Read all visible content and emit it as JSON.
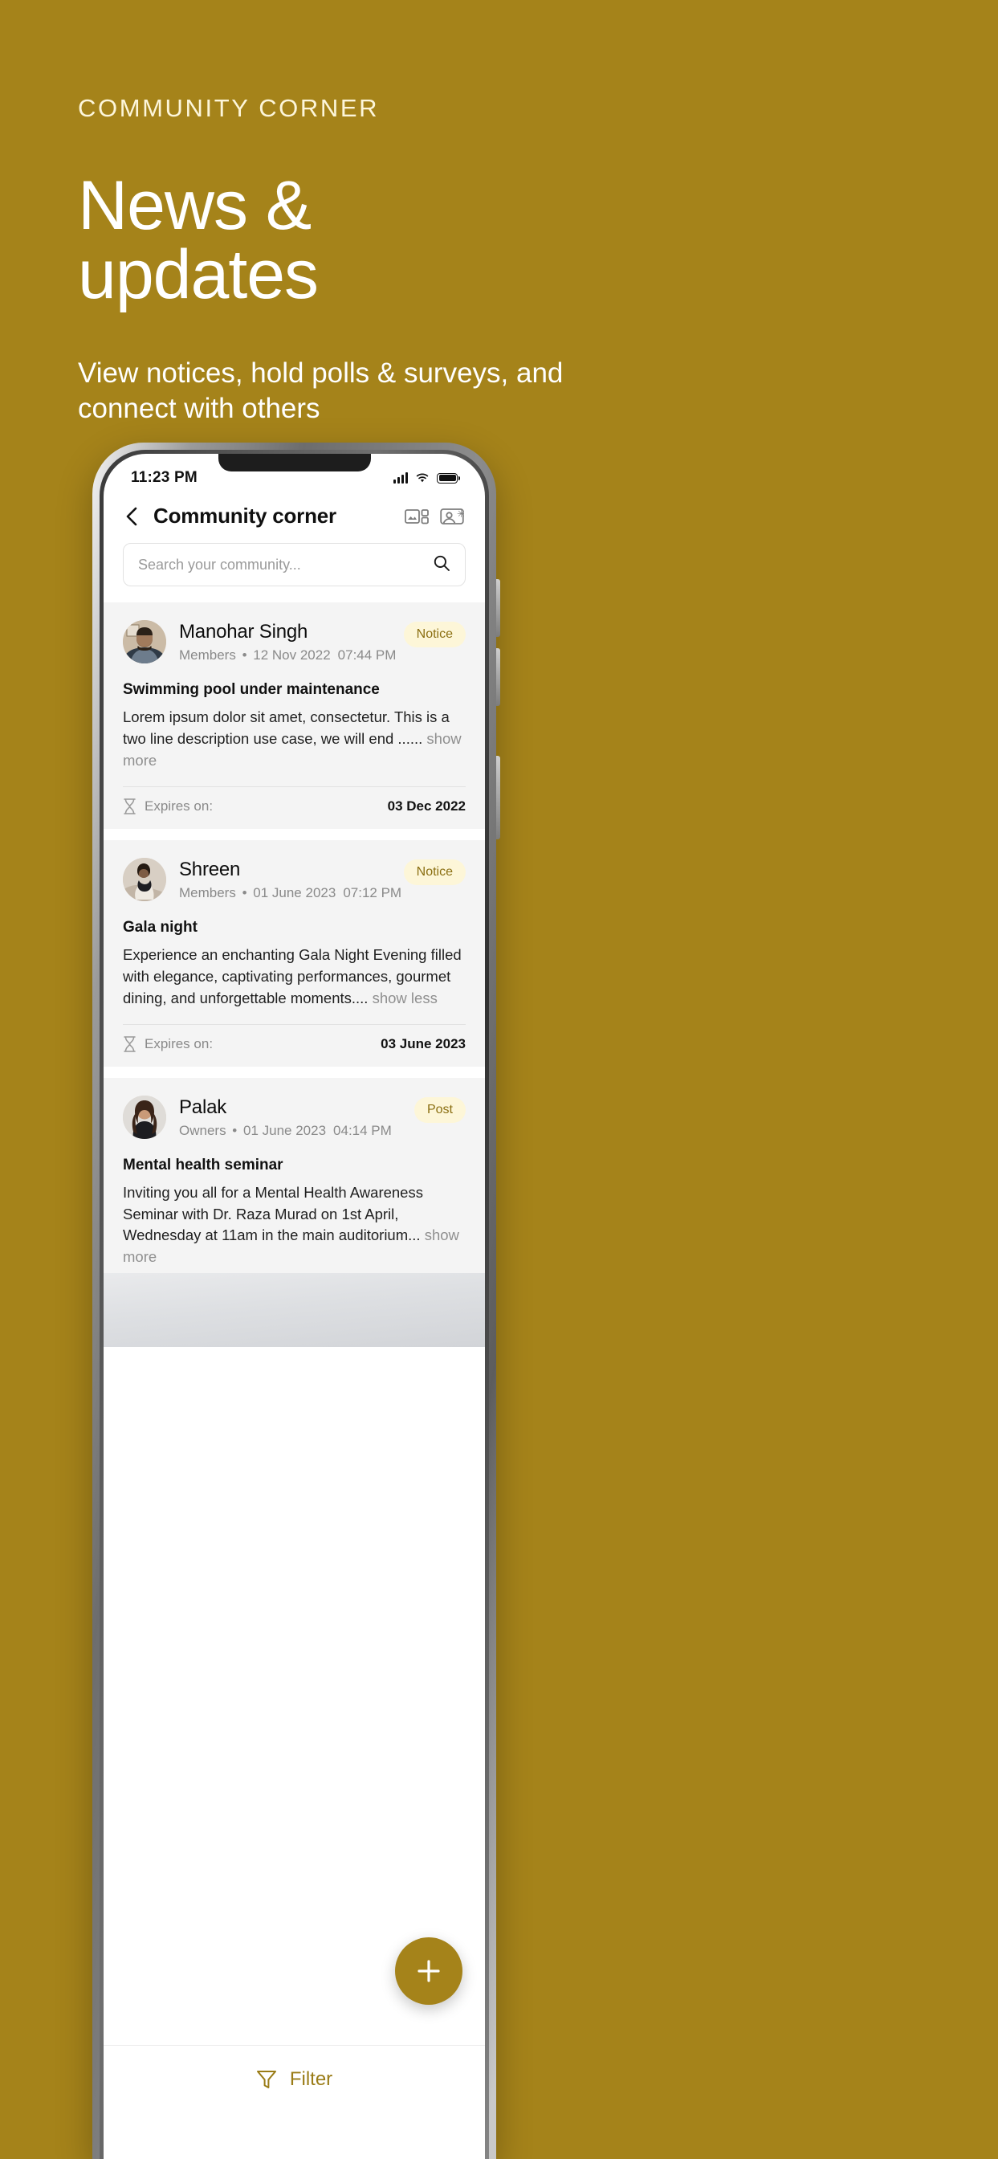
{
  "theme": {
    "brand": "#a5831a",
    "badge_bg": "#fdf6d8",
    "badge_fg": "#8b6f12",
    "card_bg": "#f4f4f4"
  },
  "promo": {
    "eyebrow": "COMMUNITY CORNER",
    "title": "News & updates",
    "description": "View notices, hold polls & surveys, and connect with others"
  },
  "status_bar": {
    "time": "11:23 PM"
  },
  "appbar": {
    "title": "Community corner",
    "back_icon": "chevron-left-icon",
    "action_icons": [
      "gallery-grid-icon",
      "contact-card-icon"
    ]
  },
  "search": {
    "placeholder": "Search your community...",
    "value": "",
    "icon": "search-icon"
  },
  "feed": {
    "posts": [
      {
        "author": "Manohar Singh",
        "role": "Members",
        "date": "12 Nov 2022",
        "time": "07:44 PM",
        "badge": "Notice",
        "title": "Swimming pool under maintenance",
        "body": "Lorem ipsum dolor sit amet, consectetur. This is a two line description use case, we will end ......",
        "toggle": "show more",
        "expires_label": "Expires on:",
        "expires_value": "03 Dec 2022",
        "has_media": false
      },
      {
        "author": "Shreen",
        "role": "Members",
        "date": "01 June 2023",
        "time": "07:12 PM",
        "badge": "Notice",
        "title": "Gala night",
        "body": "Experience an enchanting Gala Night Evening filled with elegance, captivating performances, gourmet dining, and unforgettable moments....",
        "toggle": "show less",
        "expires_label": "Expires on:",
        "expires_value": "03 June 2023",
        "has_media": false
      },
      {
        "author": "Palak",
        "role": "Owners",
        "date": "01 June 2023",
        "time": "04:14 PM",
        "badge": "Post",
        "title": "Mental health seminar",
        "body": "Inviting you all for a Mental Health Awareness Seminar with Dr. Raza Murad on 1st April, Wednesday at 11am in the main auditorium...",
        "toggle": "show more",
        "expires_label": "",
        "expires_value": "",
        "has_media": true
      }
    ]
  },
  "fab": {
    "icon": "plus-icon",
    "label": ""
  },
  "bottom_bar": {
    "filter_label": "Filter",
    "filter_icon": "funnel-icon"
  }
}
